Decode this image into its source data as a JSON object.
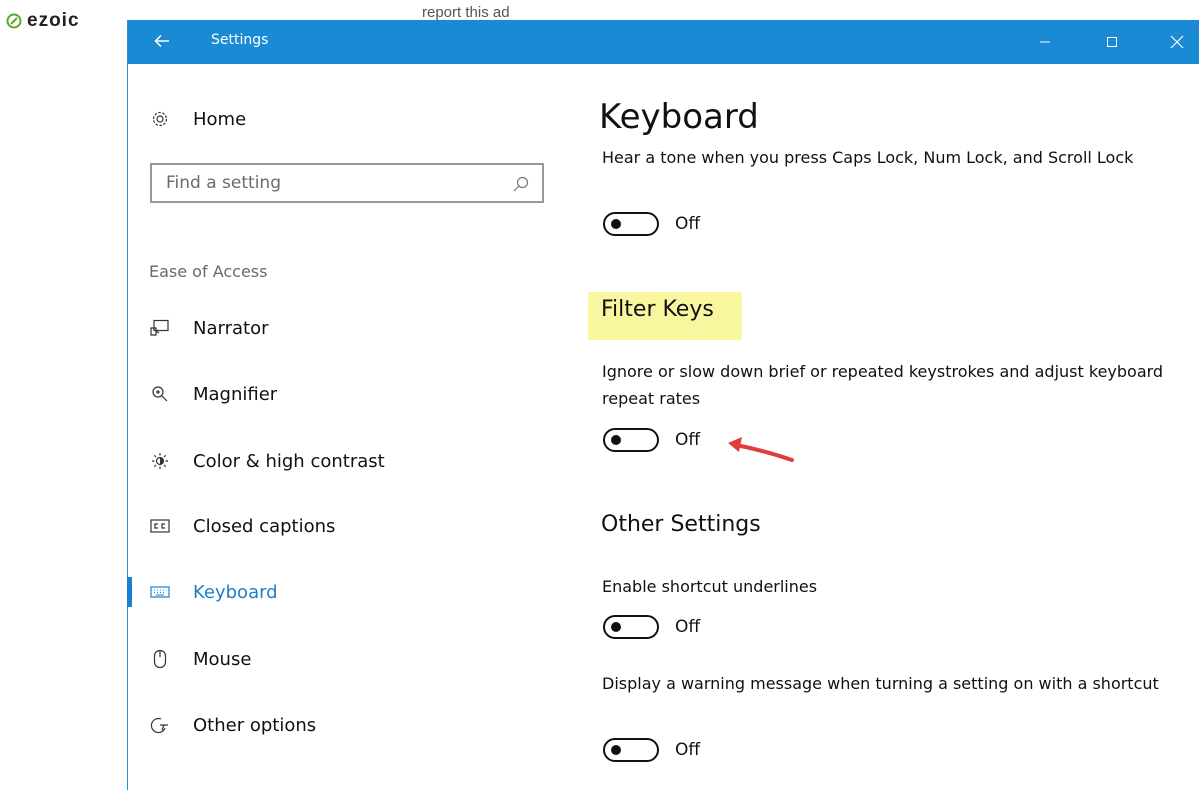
{
  "ad": {
    "brand": "ezoic",
    "report_label": "report this ad"
  },
  "window": {
    "title": "Settings",
    "controls": {
      "minimize_icon": "minimize-icon",
      "maximize_icon": "maximize-icon",
      "close_icon": "close-icon"
    },
    "accent": "#1a8ad4"
  },
  "sidebar": {
    "home_label": "Home",
    "search": {
      "placeholder": "Find a setting",
      "value": ""
    },
    "section": "Ease of Access",
    "items": [
      {
        "label": "Narrator",
        "icon": "narrator-icon",
        "active": false
      },
      {
        "label": "Magnifier",
        "icon": "magnifier-icon",
        "active": false
      },
      {
        "label": "Color & high contrast",
        "icon": "brightness-icon",
        "active": false
      },
      {
        "label": "Closed captions",
        "icon": "cc-icon",
        "active": false
      },
      {
        "label": "Keyboard",
        "icon": "keyboard-icon",
        "active": true
      },
      {
        "label": "Mouse",
        "icon": "mouse-icon",
        "active": false
      },
      {
        "label": "Other options",
        "icon": "other-options-icon",
        "active": false
      }
    ]
  },
  "main": {
    "title": "Keyboard",
    "toggle_keys": {
      "description": "Hear a tone when you press Caps Lock, Num Lock, and Scroll Lock",
      "state": "Off"
    },
    "filter_keys": {
      "heading": "Filter Keys",
      "description": "Ignore or slow down brief or repeated keystrokes and adjust keyboard repeat rates",
      "state": "Off",
      "highlight_color": "#f8f7a0"
    },
    "other_settings": {
      "heading": "Other Settings",
      "shortcut_underlines": {
        "label": "Enable shortcut underlines",
        "state": "Off"
      },
      "warning_message": {
        "label": "Display a warning message when turning a setting on with a shortcut",
        "state": "Off"
      }
    },
    "annotation_arrow_color": "#e03c3c"
  }
}
